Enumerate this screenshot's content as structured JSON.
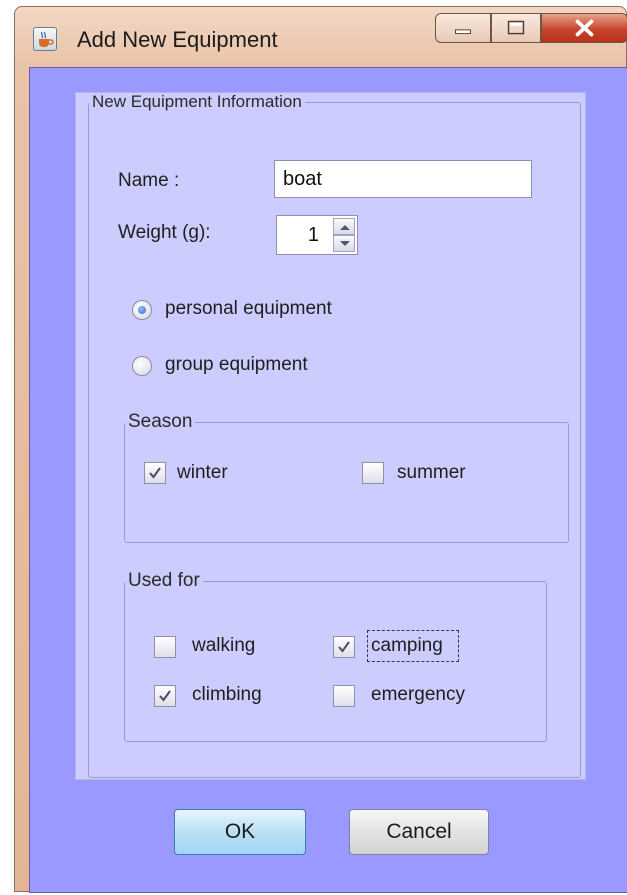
{
  "window": {
    "title": "Add New Equipment",
    "colors": {
      "client_bg": "#9999ff",
      "panel_bg": "#ccccff",
      "titlebar": "#e9c3a8",
      "close": "#c7442b"
    }
  },
  "form": {
    "group_title": "New Equipment Information",
    "name_label": "Name :",
    "name_value": "boat",
    "weight_label": "Weight (g):",
    "weight_value": "1",
    "radio_personal": {
      "label": "personal equipment",
      "selected": true
    },
    "radio_group": {
      "label": "group equipment",
      "selected": false
    },
    "season": {
      "title": "Season",
      "winter": {
        "label": "winter",
        "checked": true
      },
      "summer": {
        "label": "summer",
        "checked": false
      }
    },
    "used_for": {
      "title": "Used for",
      "walking": {
        "label": "walking",
        "checked": false
      },
      "camping": {
        "label": "camping",
        "checked": true
      },
      "climbing": {
        "label": "climbing",
        "checked": true
      },
      "emergency": {
        "label": "emergency",
        "checked": false
      }
    }
  },
  "buttons": {
    "ok": "OK",
    "cancel": "Cancel"
  },
  "icons": {
    "app": "java-cup-icon",
    "minimize": "minimize-icon",
    "maximize": "maximize-icon",
    "close": "close-icon",
    "spin_up": "arrow-up-icon",
    "spin_down": "arrow-down-icon",
    "check": "checkmark-icon"
  }
}
